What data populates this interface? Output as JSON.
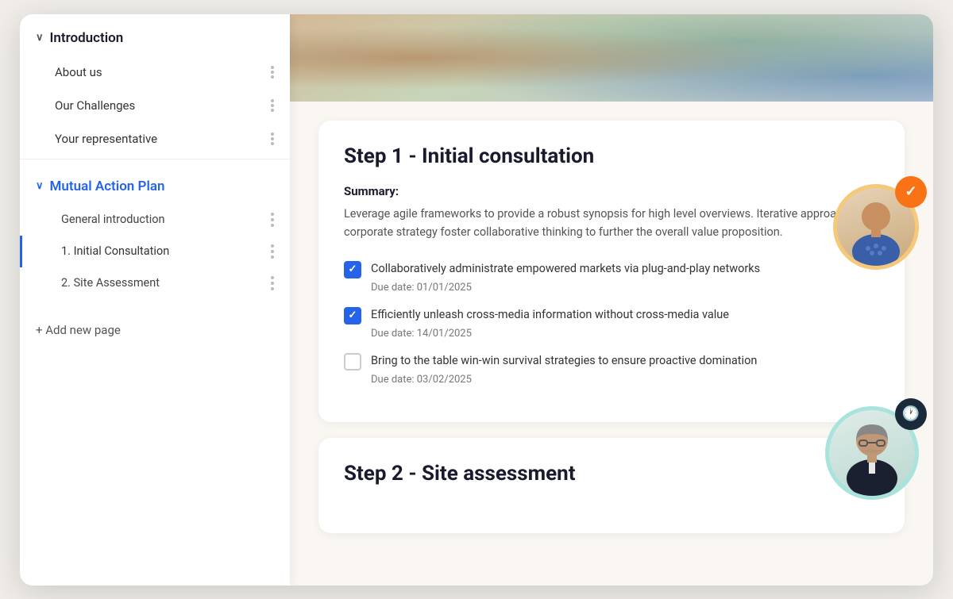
{
  "sidebar": {
    "introduction": {
      "label": "Introduction",
      "chevron": "∨",
      "items": [
        {
          "id": "about-us",
          "label": "About us"
        },
        {
          "id": "our-challenges",
          "label": "Our Challenges"
        },
        {
          "id": "your-representative",
          "label": "Your representative"
        }
      ]
    },
    "mutual_action_plan": {
      "label": "Mutual Action Plan",
      "chevron": "∨",
      "subitems": [
        {
          "id": "general-intro",
          "label": "General introduction",
          "active": false
        },
        {
          "id": "initial-consultation",
          "label": "1. Initial Consultation",
          "active": true
        },
        {
          "id": "site-assessment",
          "label": "2. Site Assessment",
          "active": false
        }
      ]
    },
    "add_page_label": "+ Add new page"
  },
  "main": {
    "step1": {
      "title": "Step 1 - Initial consultation",
      "summary_label": "Summary:",
      "summary_text": "Leverage agile frameworks to provide a robust synopsis for high level overviews. Iterative approaches to corporate strategy foster collaborative thinking to further the overall value proposition.",
      "tasks": [
        {
          "id": "task-1",
          "text": "Collaboratively administrate empowered markets via plug-and-play networks",
          "due": "Due date: 01/01/2025",
          "checked": true
        },
        {
          "id": "task-2",
          "text": "Efficiently unleash cross-media information without cross-media value",
          "due": "Due date: 14/01/2025",
          "checked": true
        },
        {
          "id": "task-3",
          "text": "Bring to the table win-win survival strategies to ensure proactive domination",
          "due": "Due date: 03/02/2025",
          "checked": false
        }
      ]
    },
    "step2": {
      "title": "Step 2 - Site assessment"
    }
  },
  "colors": {
    "blue": "#2563eb",
    "orange": "#f97316",
    "teal": "#a8e0d8",
    "gold": "#f5c87a",
    "dark": "#1a2a3a"
  }
}
